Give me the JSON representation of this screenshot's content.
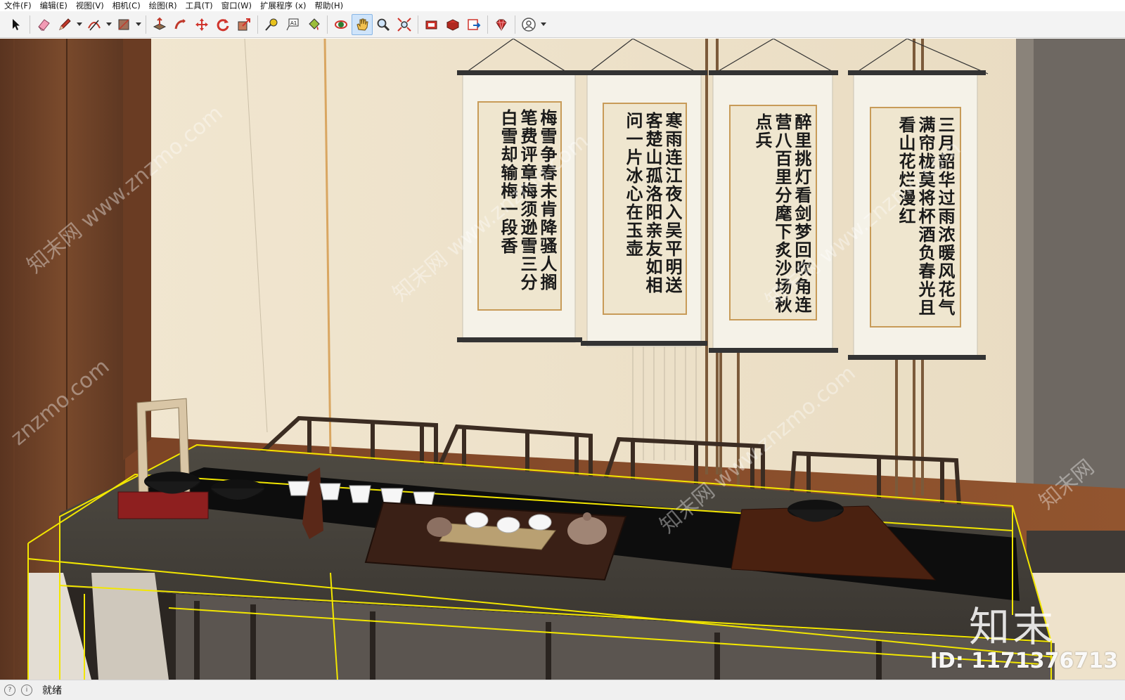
{
  "menu": [
    "文件(F)",
    "编辑(E)",
    "视图(V)",
    "相机(C)",
    "绘图(R)",
    "工具(T)",
    "窗口(W)",
    "扩展程序 (x)",
    "帮助(H)"
  ],
  "toolbar": {
    "tools": [
      "select-tool",
      "eraser-tool",
      "pencil-tool",
      "arc-tool",
      "rectangle-tool",
      "push-pull-tool",
      "follow-me-tool",
      "move-tool",
      "rotate-tool",
      "scale-tool",
      "tape-measure-tool",
      "text-tool",
      "paint-bucket-tool",
      "orbit-tool",
      "pan-tool",
      "zoom-tool",
      "zoom-extents-tool",
      "warehouse-tool",
      "extension-warehouse-tool",
      "send-to-layout-tool",
      "ruby-console-tool",
      "account-tool"
    ],
    "active_tool": "pan-tool"
  },
  "scene": {
    "scrolls": [
      {
        "text": "梅雪争春未肯降骚人搁笔费评章梅须逊雪三分白雪却输梅一段香"
      },
      {
        "text": "寒雨连江夜入吴平明送客楚山孤洛阳亲友如相问一片冰心在玉壶"
      },
      {
        "text": "醉里挑灯看剑梦回吹角连营八百里分麾下炙沙场秋点兵"
      },
      {
        "text": "三月韶华过雨浓暖风花气满帘栊莫将杯酒负春光且看山花烂漫红"
      }
    ],
    "watermarks": [
      "知末网 www.znzmo.com",
      "知末网 www.znzmo.com",
      "知末网 www.znzmo.com",
      "znzmo.com",
      "知末网 www.znzmo.com",
      "知末网"
    ],
    "brand_logo": "知末",
    "brand_id": "ID: 1171376713"
  },
  "status": {
    "text": "就绪"
  }
}
